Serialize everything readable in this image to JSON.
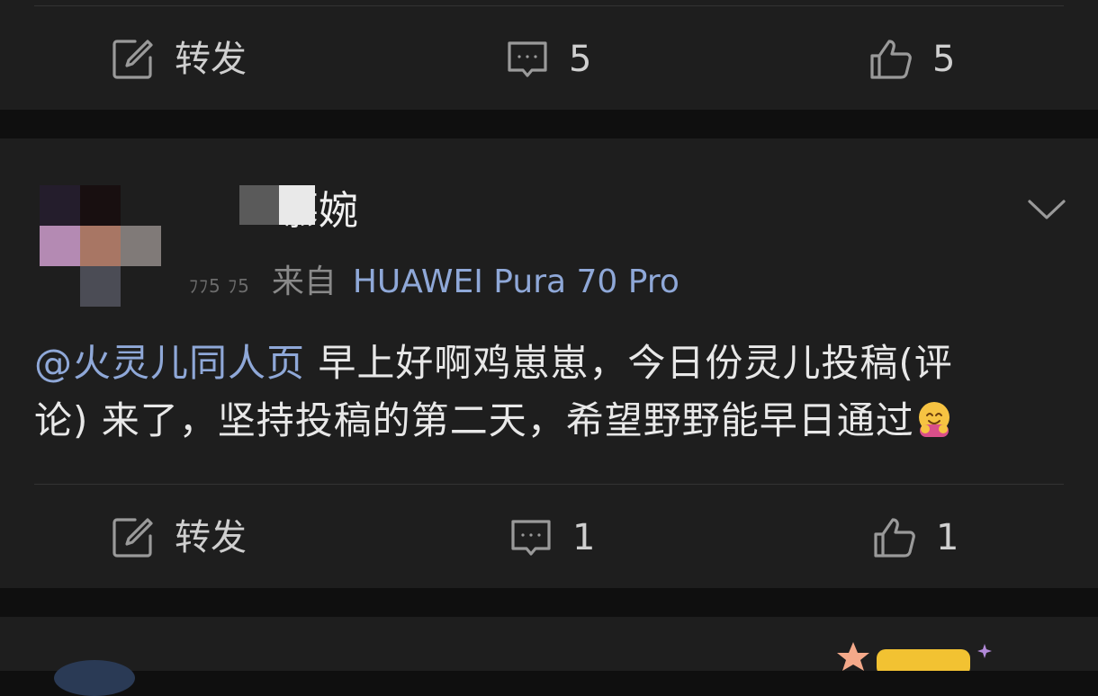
{
  "post1": {
    "repost": {
      "label": "转发",
      "icon": "repost-icon"
    },
    "comment": {
      "count": "5",
      "icon": "comment-icon"
    },
    "like": {
      "count": "5",
      "icon": "thumbs-up-icon"
    }
  },
  "post2": {
    "username": "慕婉",
    "time": "ﾌﾌ5 ﾌ5",
    "source_prefix": "来自",
    "device": "HUAWEI Pura 70 Pro",
    "mention": "@火灵儿同人页",
    "text_line1": " 早上好啊鸡崽崽，今日份灵儿投稿(评",
    "text_line2": "论) 来了，坚持投稿的第二天，希望野野能早日通过",
    "emoji": "🤗",
    "more_icon": "chevron-down-icon",
    "repost": {
      "label": "转发",
      "icon": "repost-icon"
    },
    "comment": {
      "count": "1",
      "icon": "comment-icon"
    },
    "like": {
      "count": "1",
      "icon": "thumbs-up-icon"
    }
  },
  "colors": {
    "background": "#0f0f0f",
    "card": "#1e1e1e",
    "link": "#8fa8d8",
    "text": "#e8e8e8",
    "muted": "#8a8a8a"
  }
}
